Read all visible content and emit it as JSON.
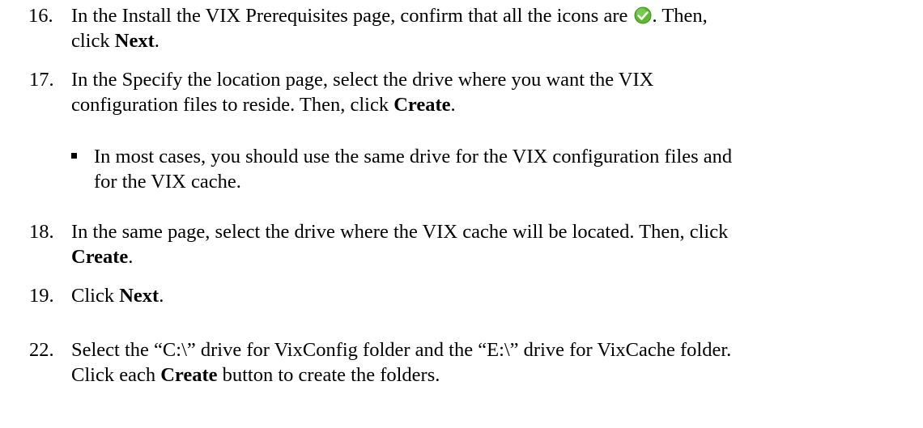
{
  "steps": {
    "s16": {
      "num": "16.",
      "before_icon": "In the Install the VIX Prerequisites page, confirm that all the icons are",
      "icon": "green-check-icon",
      "after_icon": ". Then,",
      "line2_before": "click",
      "bold": "Next",
      "line2_after": "."
    },
    "s17": {
      "num": "17.",
      "line1": "In the Specify the location page, select the drive where you want the VIX",
      "line2_before": "configuration files to reside. Then, click",
      "bold": "Create",
      "line2_after": "."
    },
    "bullet": {
      "line1": "In most cases, you should use the same drive for the VIX configuration files and",
      "line2": "for the VIX cache."
    },
    "s18": {
      "num": "18.",
      "line1": "In the same page, select the drive where the VIX cache will be located. Then, click",
      "bold": "Create",
      "line2_after": "."
    },
    "s19": {
      "num": "19.",
      "before": "Click",
      "bold": "Next",
      "after": "."
    },
    "s22": {
      "num": "22.",
      "line1": "Select the “C:\\” drive for VixConfig folder and the “E:\\” drive for VixCache folder.",
      "line2_before": "Click each",
      "bold": "Create",
      "line2_after": "button to create the folders."
    }
  },
  "colors": {
    "check_fill": "#5cb82e",
    "text": "#000000"
  }
}
